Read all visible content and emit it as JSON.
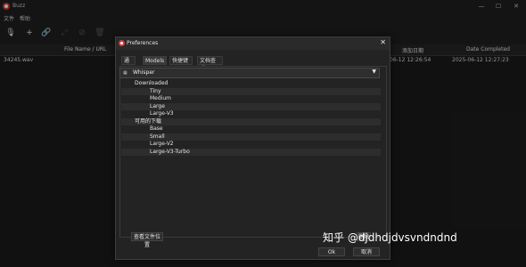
{
  "app": {
    "title": "Buzz"
  },
  "window_controls": {
    "minimize": "—",
    "maximize": "☐",
    "close": "✕"
  },
  "menu": [
    "文件",
    "帮助"
  ],
  "toolbar": {
    "icons": [
      "mic-icon",
      "plus-icon",
      "link-icon",
      "expand-icon",
      "stop-circle-icon",
      "trash-icon"
    ],
    "glyphs": [
      "🎙",
      "+",
      "🔗",
      "⤢",
      "⊘",
      "🗑"
    ]
  },
  "table": {
    "headers": {
      "file_name": "File Name / URL",
      "date_added": "添加日期",
      "date_completed": "Date Completed"
    },
    "rows": [
      {
        "file": "34245.wav",
        "date_added_partial": "06-12 12:26:54",
        "date_completed": "2025-06-12 12:27:23"
      }
    ]
  },
  "dialog": {
    "title": "Preferences",
    "close_glyph": "✕",
    "tabs": [
      "通用",
      "Models",
      "快捷键",
      "文档查看"
    ],
    "active_tab": "Models",
    "model_select": {
      "value": "Whisper",
      "arrow": "▼",
      "icon": "▦"
    },
    "groups": [
      {
        "label": "Downloaded",
        "items": [
          "Tiny",
          "Medium",
          "Large",
          "Large-V3"
        ]
      },
      {
        "label": "可用的下载",
        "items": [
          "Base",
          "Small",
          "Large-V2",
          "Large-V3-Turbo"
        ]
      }
    ],
    "buttons": {
      "show_location": "查看文件位置",
      "delete": "删除",
      "ok": "Ok",
      "cancel": "取消"
    }
  },
  "watermark": "知乎 @djdhdjdvsvndndnd"
}
